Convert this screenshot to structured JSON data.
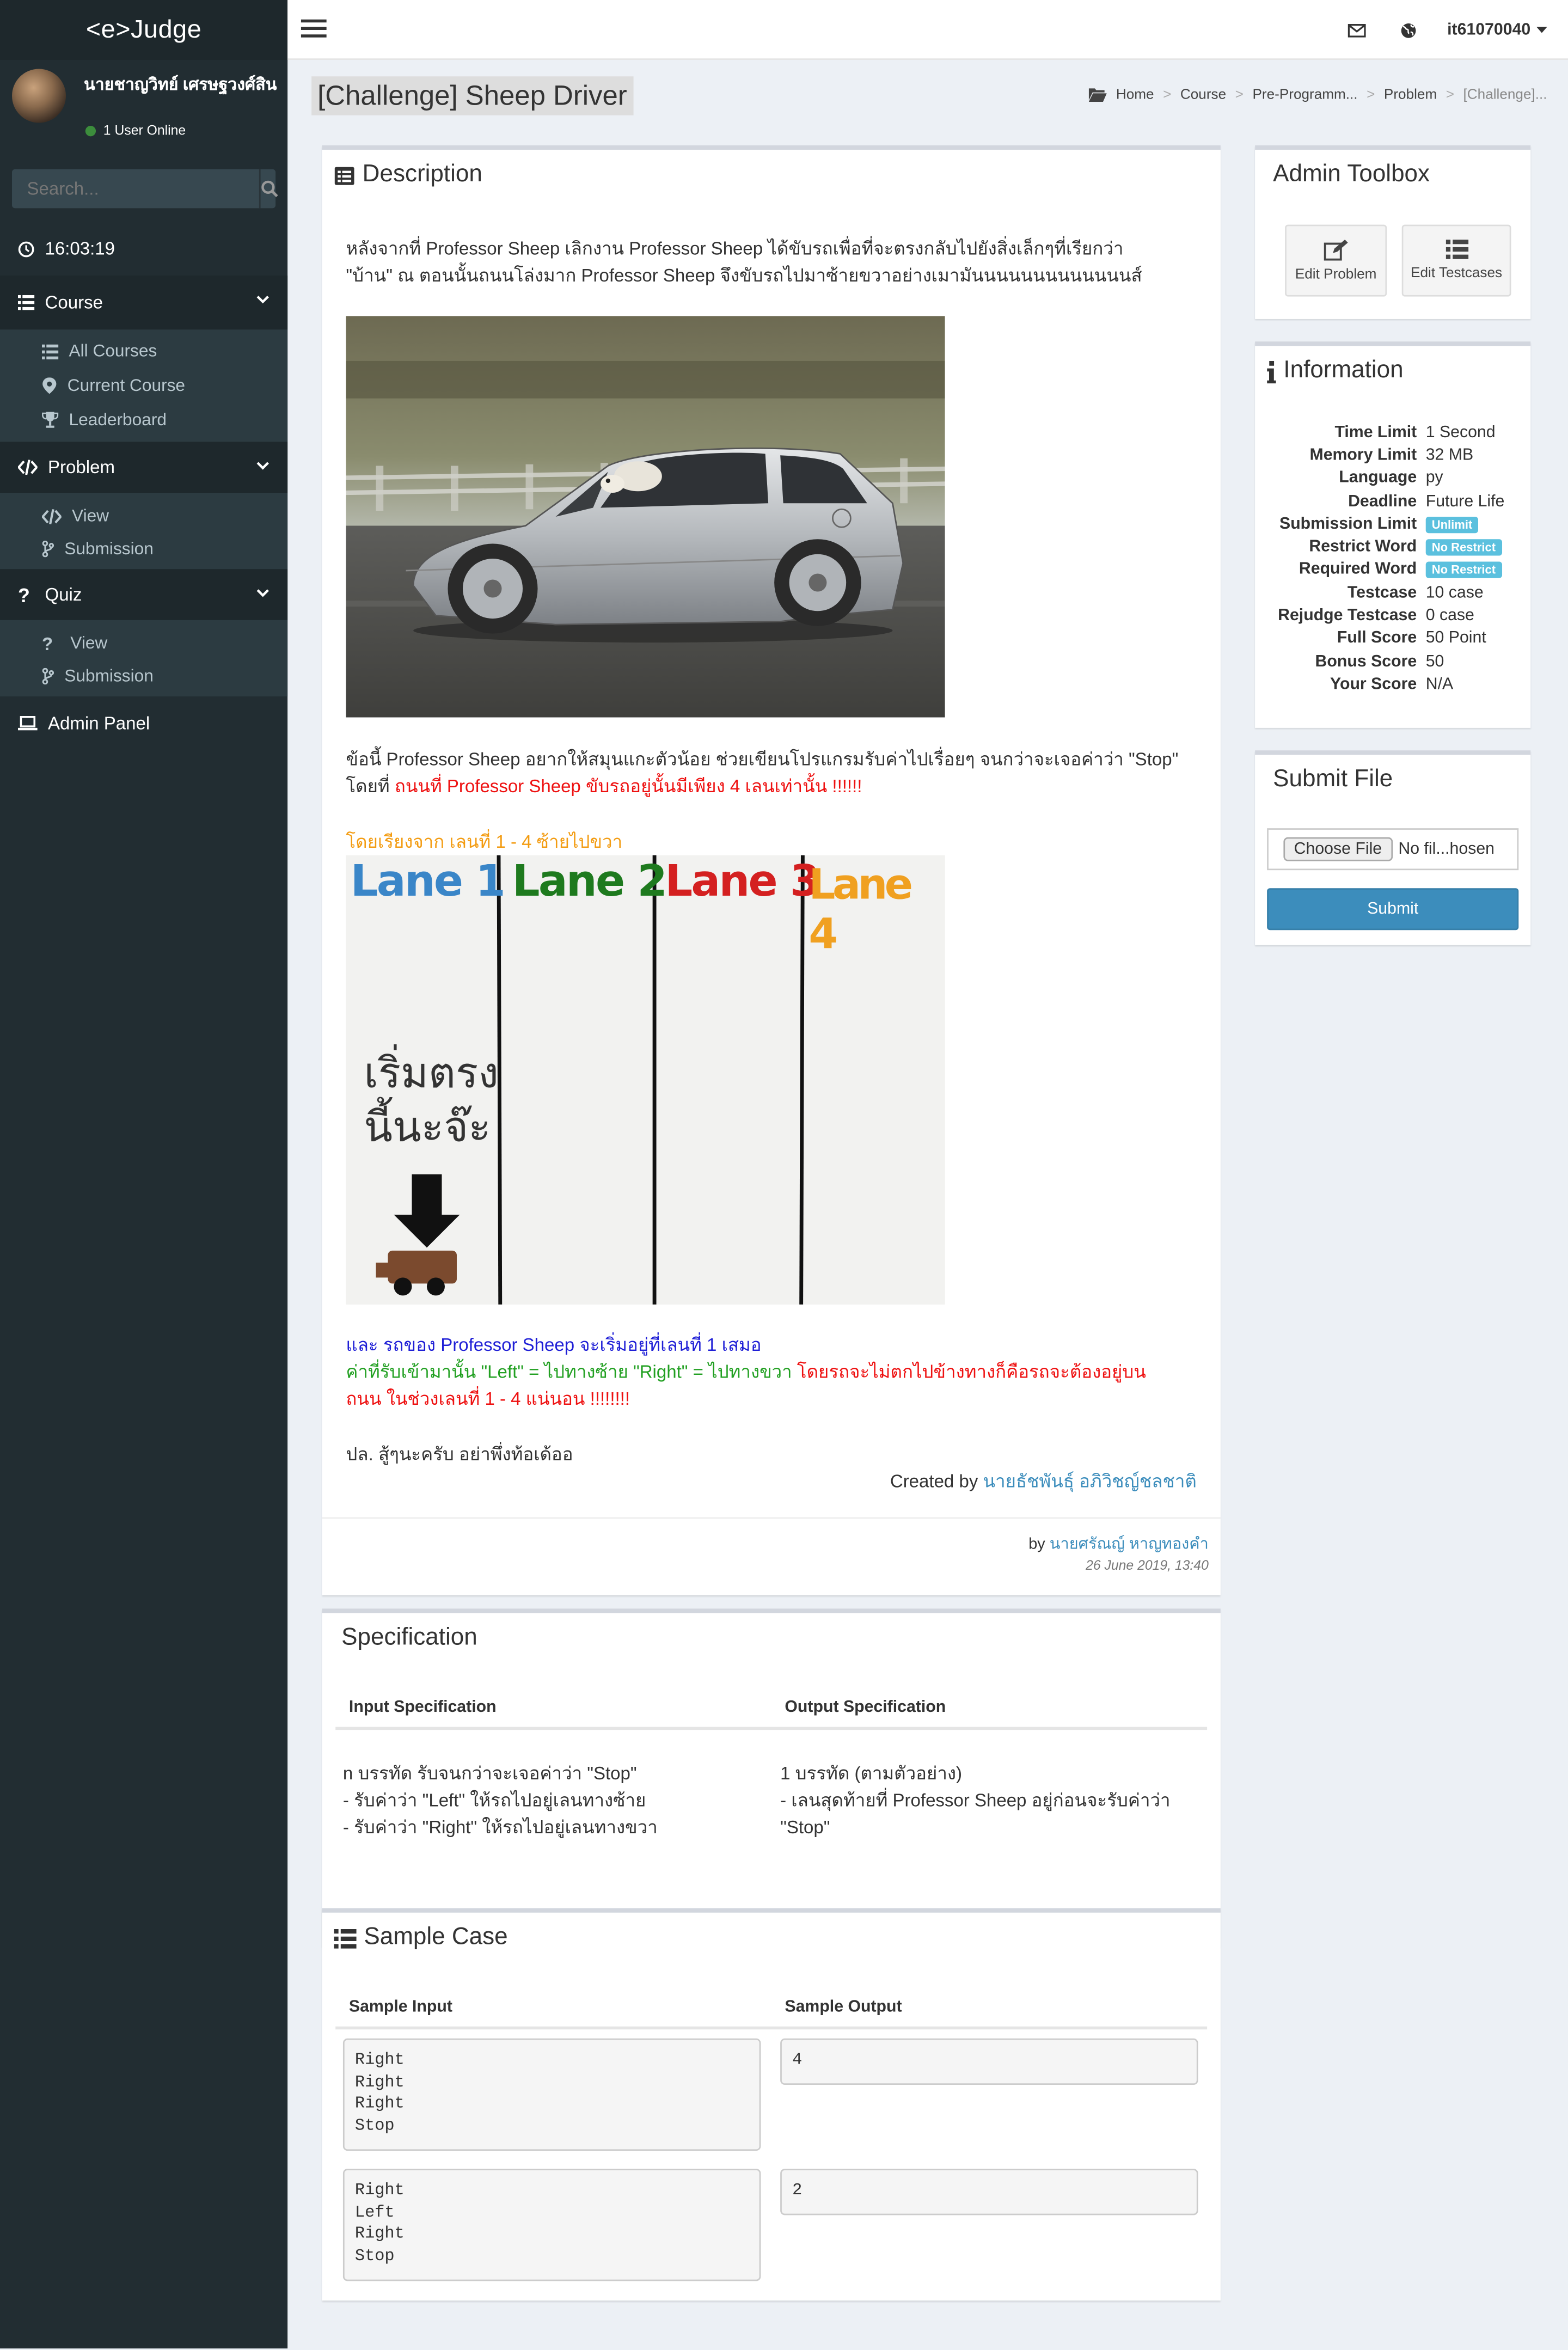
{
  "app": {
    "logo": "<e>Judge"
  },
  "user": {
    "name": "นายชาญวิทย์ เศรษฐวงศ์สิน",
    "status": "1 User Online"
  },
  "search": {
    "placeholder": "Search..."
  },
  "sidebar": {
    "clock": "16:03:19",
    "course": {
      "label": "Course",
      "items": [
        "All Courses",
        "Current Course",
        "Leaderboard"
      ]
    },
    "problem": {
      "label": "Problem",
      "items": [
        "View",
        "Submission"
      ]
    },
    "quiz": {
      "label": "Quiz",
      "items": [
        "View",
        "Submission"
      ]
    },
    "admin": "Admin Panel"
  },
  "header": {
    "username": "it61070040"
  },
  "page": {
    "title": "[Challenge] Sheep Driver"
  },
  "breadcrumb": [
    "Home",
    "Course",
    "Pre-Programm...",
    "Problem",
    "[Challenge]..."
  ],
  "description": {
    "heading": "Description",
    "para1_line1": "หลังจากที่ Professor Sheep เลิกงาน Professor Sheep ได้ขับรถเพื่อที่จะตรงกลับไปยังสิ่งเล็กๆที่เรียกว่า",
    "para1_line2": "\"บ้าน\" ณ ตอนนั้นถนนโล่งมาก Professor Sheep จึงขับรถไปมาซ้ายขวาอย่างเมามันนนนนนนนนนนนนส์",
    "para2_line1": "ข้อนี้ Professor Sheep อยากให้สมุนแกะตัวน้อย ช่วยเขียนโปรแกรมรับค่าไปเรื่อยๆ จนกว่าจะเจอค่าว่า \"Stop\"",
    "para2_line2a": "โดยที่ ",
    "para2_line2b": "ถนนที่ Professor Sheep ขับรถอยู่นั้นมีเพียง 4 เลนเท่านั้น !!!!!!",
    "lanes_caption": "โดยเรียงจาก เลนที่ 1 - 4 ซ้ายไปขวา",
    "lanes": [
      "Lane 1",
      "Lane 2",
      "Lane 3",
      "Lane 4"
    ],
    "lane_colors": [
      "#3a86c8",
      "#1e7a1e",
      "#d42020",
      "#f0a020"
    ],
    "handwriting1": "เริ่มตรง",
    "handwriting2": "นี้นะจ๊ะ",
    "para3": "และ รถของ Professor Sheep จะเริ่มอยู่ที่เลนที่ 1 เสมอ",
    "para4a": "ค่าที่รับเข้ามานั้น \"Left\" = ไปทางซ้าย \"Right\" = ไปทางขวา ",
    "para4b": "โดยรถจะไม่ตกไปข้างทางก็คือรถจะต้องอยู่บน",
    "para4c": "ถนน ในช่วงเลนที่ 1 - 4 แน่นอน !!!!!!!!",
    "para5": "ปล. สู้ๆนะครับ อย่าพึ่งท้อเด้ออ",
    "created_label": "Created by ",
    "created_by": "นายธัชพันธุ์ อภิวิชญ์ชลชาติ",
    "by_label": "by ",
    "author": "นายศรัณญ์ หาญทองคำ",
    "date": "26 June 2019, 13:40"
  },
  "specification": {
    "heading": "Specification",
    "input_header": "Input Specification",
    "output_header": "Output Specification",
    "input_lines": [
      "n บรรทัด รับจนกว่าจะเจอค่าว่า \"Stop\"",
      "- รับค่าว่า \"Left\" ให้รถไปอยู่เลนทางซ้าย",
      "- รับค่าว่า \"Right\" ให้รถไปอยู่เลนทางขวา"
    ],
    "output_lines": [
      "1 บรรทัด (ตามตัวอย่าง)",
      "- เลนสุดท้ายที่ Professor Sheep อยู่ก่อนจะรับค่าว่า",
      "\"Stop\""
    ]
  },
  "sample": {
    "heading": "Sample Case",
    "input_header": "Sample Input",
    "output_header": "Sample Output",
    "cases": [
      {
        "input": "Right\nRight\nRight\nStop",
        "output": "4"
      },
      {
        "input": "Right\nLeft\nRight\nStop",
        "output": "2"
      }
    ]
  },
  "toolbox": {
    "heading": "Admin Toolbox",
    "edit_problem": "Edit Problem",
    "edit_testcases": "Edit Testcases"
  },
  "information": {
    "heading": "Information",
    "rows": [
      {
        "k": "Time Limit",
        "v": "1 Second"
      },
      {
        "k": "Memory Limit",
        "v": "32 MB"
      },
      {
        "k": "Language",
        "v": "py"
      },
      {
        "k": "Deadline",
        "v": "Future Life"
      },
      {
        "k": "Submission Limit",
        "v": "Unlimit",
        "badge": true
      },
      {
        "k": "Restrict Word",
        "v": "No Restrict",
        "badge": true
      },
      {
        "k": "Required Word",
        "v": "No Restrict",
        "badge": true
      },
      {
        "k": "Testcase",
        "v": "10 case"
      },
      {
        "k": "Rejudge Testcase",
        "v": "0 case"
      },
      {
        "k": "Full Score",
        "v": "50 Point"
      },
      {
        "k": "Bonus Score",
        "v": "50"
      },
      {
        "k": "Your Score",
        "v": "N/A"
      }
    ]
  },
  "submit": {
    "heading": "Submit File",
    "choose": "Choose File",
    "no_file": "No fil...hosen",
    "button": "Submit"
  }
}
